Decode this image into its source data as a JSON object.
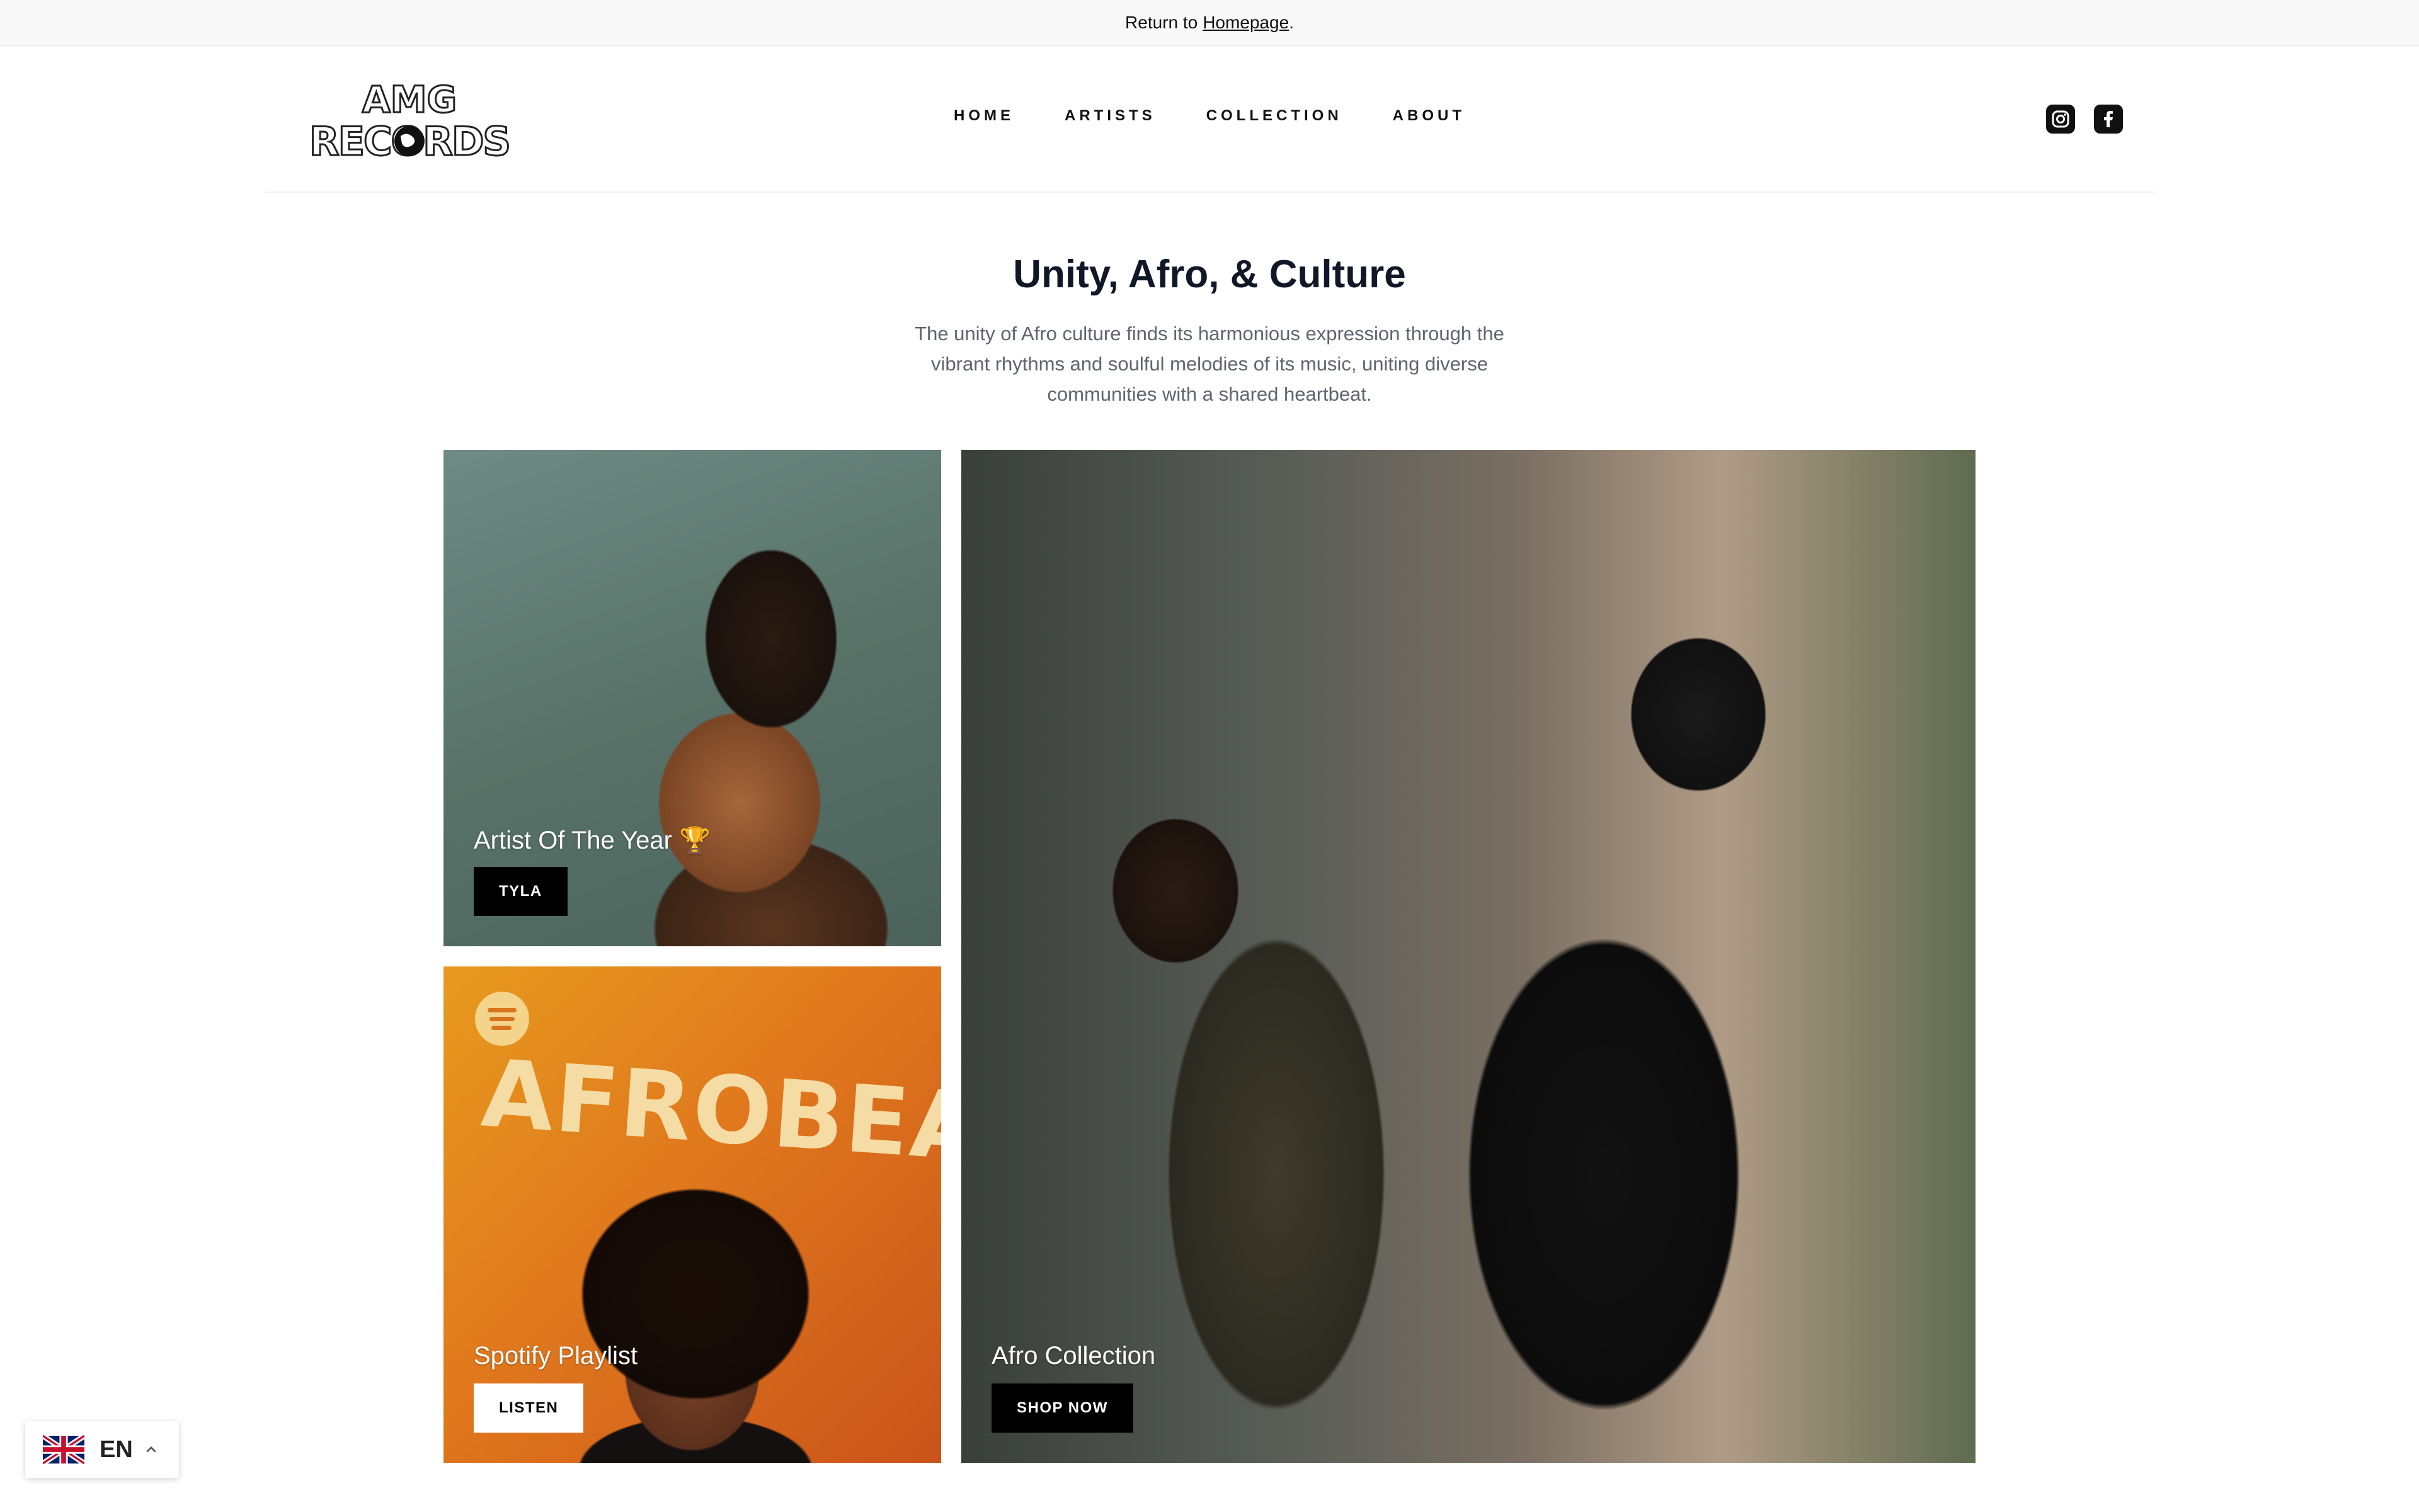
{
  "announcement": {
    "prefix": "Return to",
    "link": "Homepage",
    "suffix": "."
  },
  "header": {
    "logo_text": {
      "line1": "AMG",
      "line2": "RECORDS"
    },
    "nav": [
      "HOME",
      "ARTISTS",
      "COLLECTION",
      "ABOUT"
    ],
    "social": [
      "instagram-icon",
      "facebook-icon"
    ]
  },
  "hero": {
    "title": "Unity, Afro, & Culture",
    "description": "The unity of Afro culture finds its harmonious expression through the vibrant rhythms and soulful melodies of its music, uniting diverse communities with a shared heartbeat."
  },
  "tiles": {
    "tyla": {
      "label": "Artist Of The Year 🏆",
      "button": "TYLA"
    },
    "spotify": {
      "overlay_word": "AFROBEATS",
      "label": "Spotify Playlist",
      "button": "LISTEN"
    },
    "afro": {
      "label": "Afro Collection",
      "button": "SHOP NOW"
    }
  },
  "language": {
    "code": "EN"
  },
  "colors": {
    "text": "#111111",
    "heading": "#101828",
    "muted": "#5f6470",
    "button_dark": "#000000"
  }
}
